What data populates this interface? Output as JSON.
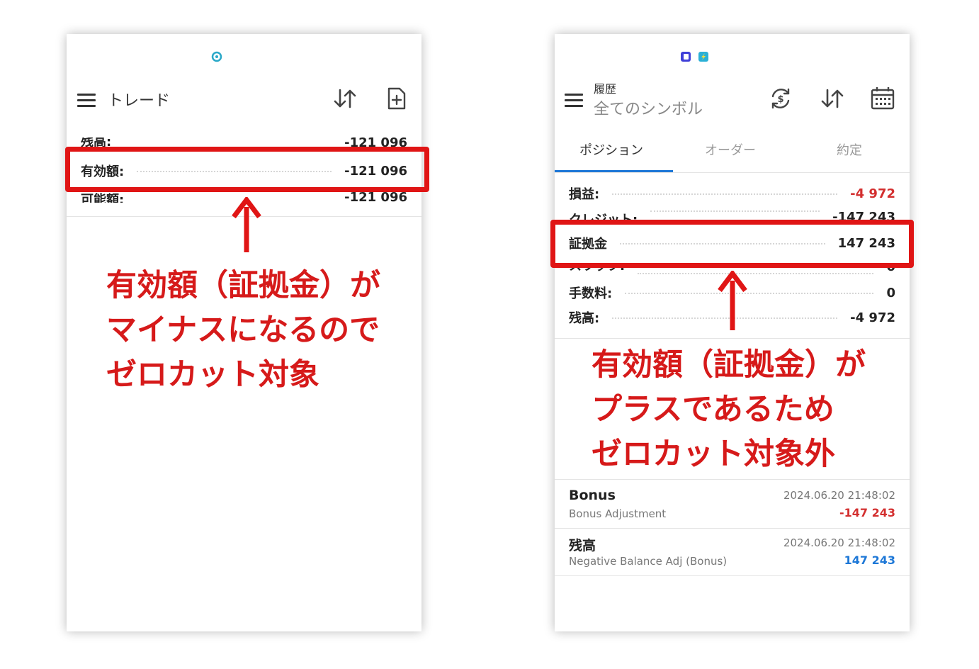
{
  "left": {
    "title": "トレード",
    "rows": [
      {
        "label": "残高:",
        "value": "-121 096"
      },
      {
        "label": "有効額:",
        "value": "-121 096"
      },
      {
        "label": "可能額:",
        "value": "-121 096"
      }
    ],
    "annotation": [
      "有効額（証拠金）が",
      "マイナスになるので",
      "ゼロカット対象"
    ]
  },
  "right": {
    "title": "履歴",
    "subtitle": "全てのシンボル",
    "tabs": [
      "ポジション",
      "オーダー",
      "約定"
    ],
    "rows": [
      {
        "label": "損益:",
        "value": "-4 972",
        "negative": true
      },
      {
        "label": "クレジット:",
        "value": "-147 243"
      },
      {
        "label": "証拠金",
        "value": "147 243"
      },
      {
        "label": "スワップ:",
        "value": "0"
      },
      {
        "label": "手数料:",
        "value": "0"
      },
      {
        "label": "残高:",
        "value": "-4 972"
      }
    ],
    "annotation": [
      "有効額（証拠金）が",
      "プラスであるため",
      "ゼロカット対象外"
    ],
    "deals": [
      {
        "title": "Bonus",
        "subtitle": "Bonus Adjustment",
        "time": "2024.06.20 21:48:02",
        "amount": "-147 243",
        "amount_color": "#d32f2f"
      },
      {
        "title": "残高",
        "subtitle": "Negative Balance Adj (Bonus)",
        "time": "2024.06.20 21:48:02",
        "amount": "147 243",
        "amount_color": "#1e78d7"
      }
    ]
  },
  "colors": {
    "highlight": "#e01515",
    "annotation": "#d61a1a",
    "negative": "#d32f2f",
    "accent": "#1e78d7"
  },
  "icons": [
    "menu-icon",
    "sort-icon",
    "new-order-icon",
    "currency-exchange-icon",
    "calendar-icon",
    "arrow-up-icon"
  ]
}
